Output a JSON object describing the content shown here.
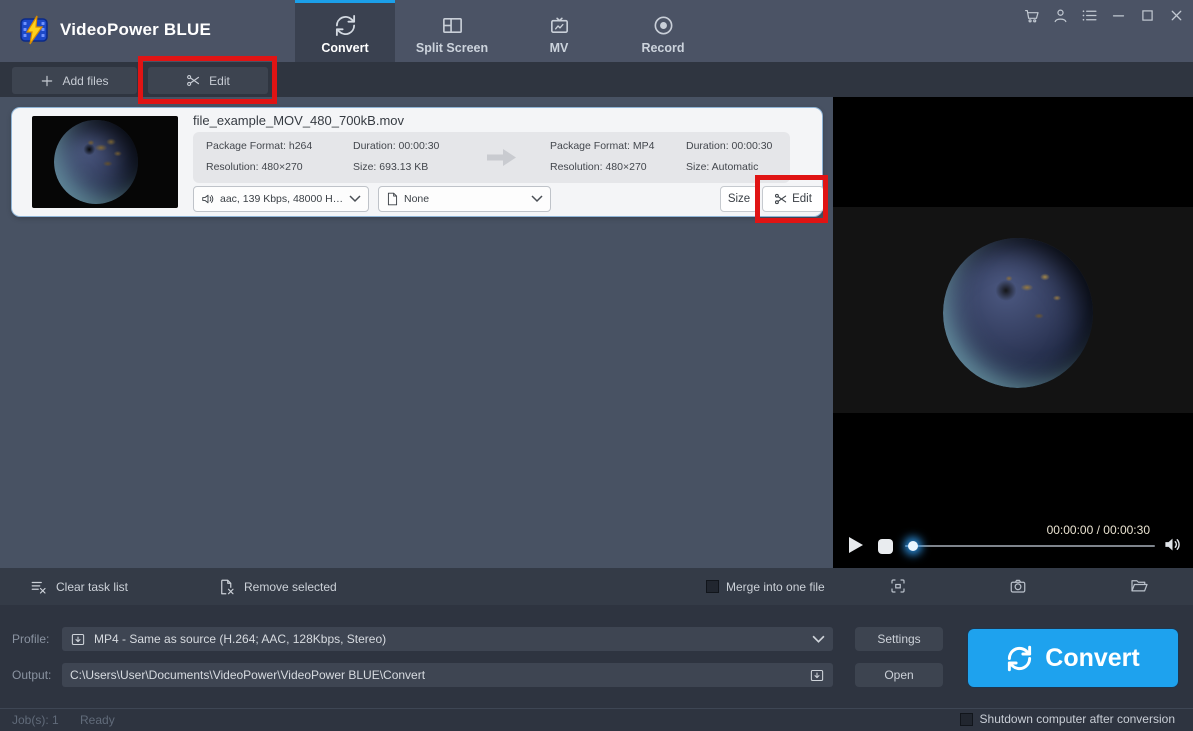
{
  "titlebar": {
    "app_title": "VideoPower BLUE",
    "tabs": [
      {
        "label": "Convert",
        "active": true
      },
      {
        "label": "Split Screen",
        "active": false
      },
      {
        "label": "MV",
        "active": false
      },
      {
        "label": "Record",
        "active": false
      }
    ],
    "window_icons": [
      "cart",
      "user",
      "menu",
      "minimize",
      "maximize",
      "close"
    ]
  },
  "toolbar": {
    "add_files_label": "Add files",
    "edit_label": "Edit"
  },
  "task_card": {
    "filename": "file_example_MOV_480_700kB.mov",
    "source": {
      "format": "Package Format: h264",
      "duration": "Duration: 00:00:30",
      "resolution": "Resolution: 480×270",
      "size": "Size: 693.13 KB"
    },
    "target": {
      "format": "Package Format: MP4",
      "duration": "Duration: 00:00:30",
      "resolution": "Resolution: 480×270",
      "size": "Size: Automatic"
    },
    "audio_track": "aac, 139 Kbps, 48000 Hz...",
    "subtitle": "None",
    "size_label": "Size",
    "edit_label": "Edit"
  },
  "player": {
    "time": "00:00:00 / 00:00:30"
  },
  "action_bar": {
    "clear_label": "Clear task list",
    "remove_label": "Remove selected",
    "merge_label": "Merge into one file",
    "merge_checked": false,
    "right_icons": [
      "fullscreen",
      "snapshot-camera",
      "open-folder"
    ]
  },
  "output_panel": {
    "profile_label": "Profile:",
    "profile_value": "MP4 - Same as source (H.264; AAC, 128Kbps, Stereo)",
    "output_label": "Output:",
    "output_path": "C:\\Users\\User\\Documents\\VideoPower\\VideoPower BLUE\\Convert",
    "settings_label": "Settings",
    "open_label": "Open",
    "convert_label": "Convert"
  },
  "status_bar": {
    "jobs": "Job(s): 1",
    "state": "Ready",
    "shutdown_label": "Shutdown computer after conversion",
    "shutdown_checked": false
  },
  "annotations": {
    "color": "#e01414",
    "highlight_boxes": [
      "toolbar-edit-button",
      "card-edit-button"
    ]
  },
  "colors": {
    "accent_blue": "#1ea2ee",
    "titlebar_bg": "#4b5365",
    "task_bg": "#485263",
    "panel_dark": "#2e3440"
  }
}
